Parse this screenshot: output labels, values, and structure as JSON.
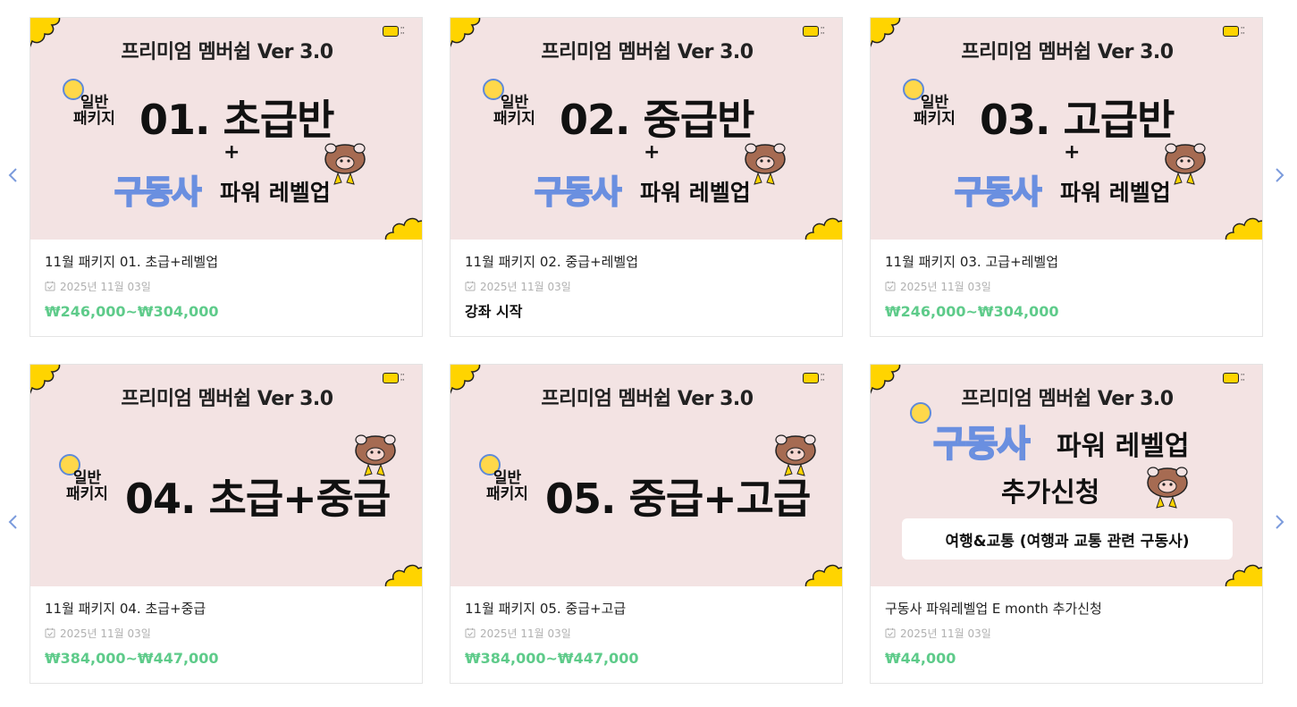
{
  "colors": {
    "price_green": "#5ecb8a",
    "thumb_bg": "#f3e3e3",
    "accent_yellow": "#ffd400",
    "arrow_blue": "#7b9bdc",
    "date_gray": "#b0b0b0"
  },
  "nav": {
    "prev_icon": "chevron-left-icon",
    "next_icon": "chevron-right-icon"
  },
  "products": [
    {
      "banner": {
        "title": "프리미엄 멤버쉽 Ver 3.0",
        "pkg_small_1": "일반",
        "pkg_small_2": "패키지",
        "pkg_big": "01. 초급반",
        "plus": "+",
        "gudongsa": "구동사",
        "powerlevel": "파워 레벨업"
      },
      "title": "11월 패키지 01. 초급+레벨업",
      "date": "2025년 11월 03일",
      "price": "₩246,000~₩304,000"
    },
    {
      "banner": {
        "title": "프리미엄 멤버쉽 Ver 3.0",
        "pkg_small_1": "일반",
        "pkg_small_2": "패키지",
        "pkg_big": "02. 중급반",
        "plus": "+",
        "gudongsa": "구동사",
        "powerlevel": "파워 레벨업"
      },
      "title": "11월 패키지 02. 중급+레벨업",
      "date": "2025년 11월 03일",
      "price": "강좌 시작"
    },
    {
      "banner": {
        "title": "프리미엄 멤버쉽 Ver 3.0",
        "pkg_small_1": "일반",
        "pkg_small_2": "패키지",
        "pkg_big": "03. 고급반",
        "plus": "+",
        "gudongsa": "구동사",
        "powerlevel": "파워 레벨업"
      },
      "title": "11월 패키지 03. 고급+레벨업",
      "date": "2025년 11월 03일",
      "price": "₩246,000~₩304,000"
    },
    {
      "banner": {
        "title": "프리미엄 멤버쉽 Ver 3.0",
        "pkg_small_1": "일반",
        "pkg_small_2": "패키지",
        "pkg_big": "04. 초급+중급"
      },
      "title": "11월 패키지 04. 초급+중급",
      "date": "2025년 11월 03일",
      "price": "₩384,000~₩447,000"
    },
    {
      "banner": {
        "title": "프리미엄 멤버쉽 Ver 3.0",
        "pkg_small_1": "일반",
        "pkg_small_2": "패키지",
        "pkg_big": "05. 중급+고급"
      },
      "title": "11월 패키지 05. 중급+고급",
      "date": "2025년 11월 03일",
      "price": "₩384,000~₩447,000"
    },
    {
      "banner": {
        "title": "프리미엄 멤버쉽 Ver 3.0",
        "gudongsa": "구동사",
        "powerlevel": "파워 레벨업",
        "addreq": "추가신청",
        "box_text": "여행&교통 (여행과 교통 관련 구동사)"
      },
      "title": "구동사 파워레벨업 E month 추가신청",
      "date": "2025년 11월 03일",
      "price": "₩44,000"
    }
  ]
}
